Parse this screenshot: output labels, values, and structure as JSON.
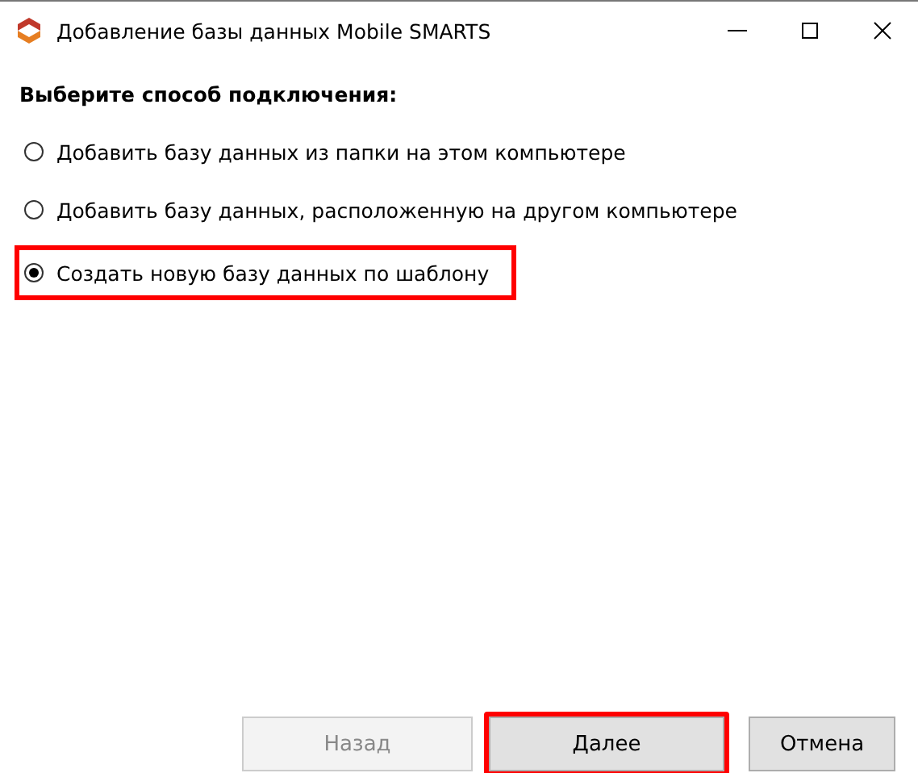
{
  "window": {
    "title": "Добавление базы данных Mobile SMARTS"
  },
  "heading": "Выберите способ подключения:",
  "options": [
    {
      "label": "Добавить базу данных из папки на этом компьютере",
      "selected": false,
      "highlighted": false
    },
    {
      "label": "Добавить базу данных, расположенную на другом компьютере",
      "selected": false,
      "highlighted": false
    },
    {
      "label": "Создать новую базу данных по шаблону",
      "selected": true,
      "highlighted": true
    }
  ],
  "buttons": [
    {
      "label": "Назад",
      "disabled": true,
      "highlighted": false
    },
    {
      "label": "Далее",
      "disabled": false,
      "highlighted": true
    },
    {
      "label": "Отмена",
      "disabled": false,
      "highlighted": false
    }
  ]
}
